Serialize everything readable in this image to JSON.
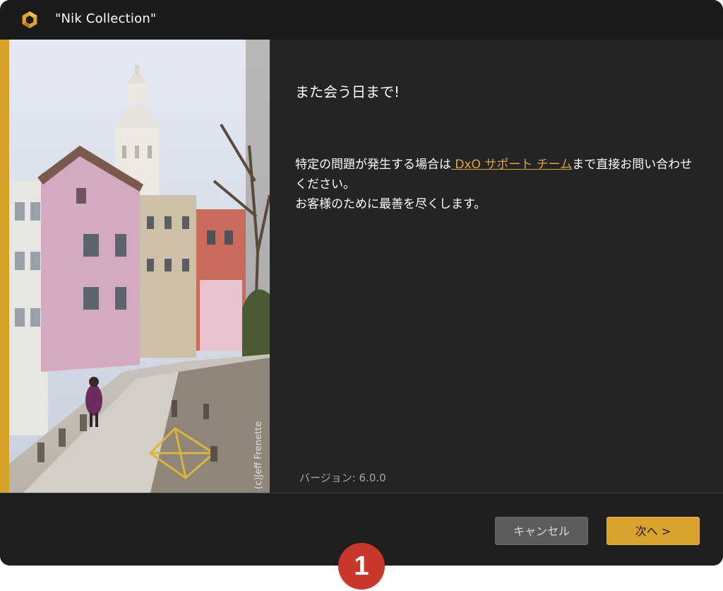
{
  "window": {
    "title": "\"Nik Collection\"",
    "app_icon": "nik-collection-logo-icon"
  },
  "photo": {
    "credit": "(c)Jeff Frenette"
  },
  "panel": {
    "heading": "また会う日まで!",
    "message_before_link": "特定の問題が発生する場合は",
    "link_text": " DxO サポート チーム",
    "message_after_link": "まで直接お問い合わせください。",
    "message_line2": "お客様のために最善を尽くします。",
    "version_label": "バージョン: 6.0.0"
  },
  "footer": {
    "cancel_label": "キャンセル",
    "next_label": "次へ >"
  },
  "annotation": {
    "step_number": "1"
  },
  "colors": {
    "accent": "#d8a228",
    "link": "#e0a43a",
    "background": "#222222",
    "marker": "#c9372c"
  }
}
